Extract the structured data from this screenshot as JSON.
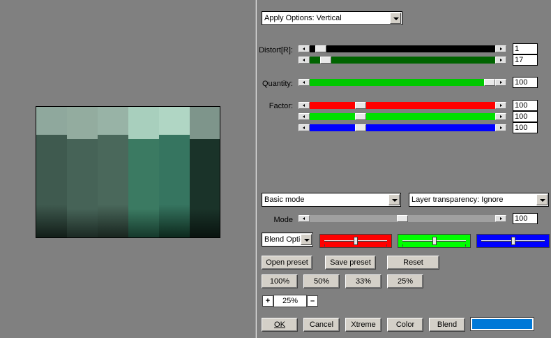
{
  "apply_options": {
    "label": "Apply Options: Vertical"
  },
  "distort": {
    "label": "Distort[R]:",
    "row1": {
      "value": "1",
      "fraction": 0.03,
      "fill": "#000000"
    },
    "row2": {
      "value": "17",
      "fraction": 0.06,
      "fill": "#006400"
    }
  },
  "quantity": {
    "label": "Quantity:",
    "value": "100",
    "fraction": 1.0,
    "fill": "#00c800"
  },
  "factor": {
    "label": "Factor:",
    "rows": [
      {
        "value": "100",
        "fraction": 0.26,
        "fill": "#ff0000"
      },
      {
        "value": "100",
        "fraction": 0.26,
        "fill": "#00e000"
      },
      {
        "value": "100",
        "fraction": 0.26,
        "fill": "#0000ff"
      }
    ]
  },
  "mode_select": {
    "label": "Basic mode"
  },
  "layer_transparency": {
    "label": "Layer transparency: Ignore"
  },
  "mode": {
    "label": "Mode",
    "value": "100",
    "fraction": 0.5
  },
  "blend_options": {
    "label": "Blend Optio"
  },
  "color_sliders": {
    "red": {
      "color": "#ff0000",
      "fraction": 0.5
    },
    "green": {
      "color": "#00ff00",
      "fraction": 0.5
    },
    "blue": {
      "color": "#0000ff",
      "fraction": 0.5
    }
  },
  "presets": {
    "open": "Open preset",
    "save": "Save preset",
    "reset": "Reset"
  },
  "zoom_buttons": [
    "100%",
    "50%",
    "33%",
    "25%"
  ],
  "zoom": {
    "plus": "+",
    "value": "25%",
    "minus": "–"
  },
  "actions": {
    "ok": "OK",
    "cancel": "Cancel",
    "xtreme": "Xtreme",
    "color": "Color",
    "blend": "Blend"
  },
  "color_swatch": "#0078d7"
}
